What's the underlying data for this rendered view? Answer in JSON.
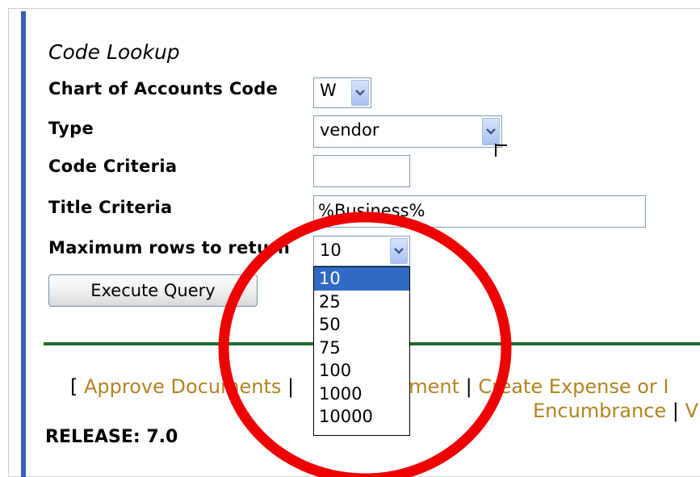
{
  "form": {
    "heading": "Code Lookup",
    "chart_label": "Chart of Accounts Code",
    "chart_value": "W",
    "type_label": "Type",
    "type_value": "vendor",
    "code_label": "Code Criteria",
    "code_value": "",
    "title_label": "Title Criteria",
    "title_value": "%Business%",
    "max_label": "Maximum rows to return",
    "max_value": "10",
    "max_options": [
      "10",
      "25",
      "50",
      "75",
      "100",
      "1000",
      "10000"
    ],
    "execute_label": "Execute Query"
  },
  "footer": {
    "open_bracket": "[",
    "approve_link": "Approve Documents",
    "sep": "|",
    "partial_link": "ument",
    "create_link": "Create Expense or I",
    "encumbrance_link": "Encumbrance",
    "trailing": "V",
    "release": "RELEASE: 7.0"
  },
  "annotation": {
    "color": "#ee0000"
  }
}
